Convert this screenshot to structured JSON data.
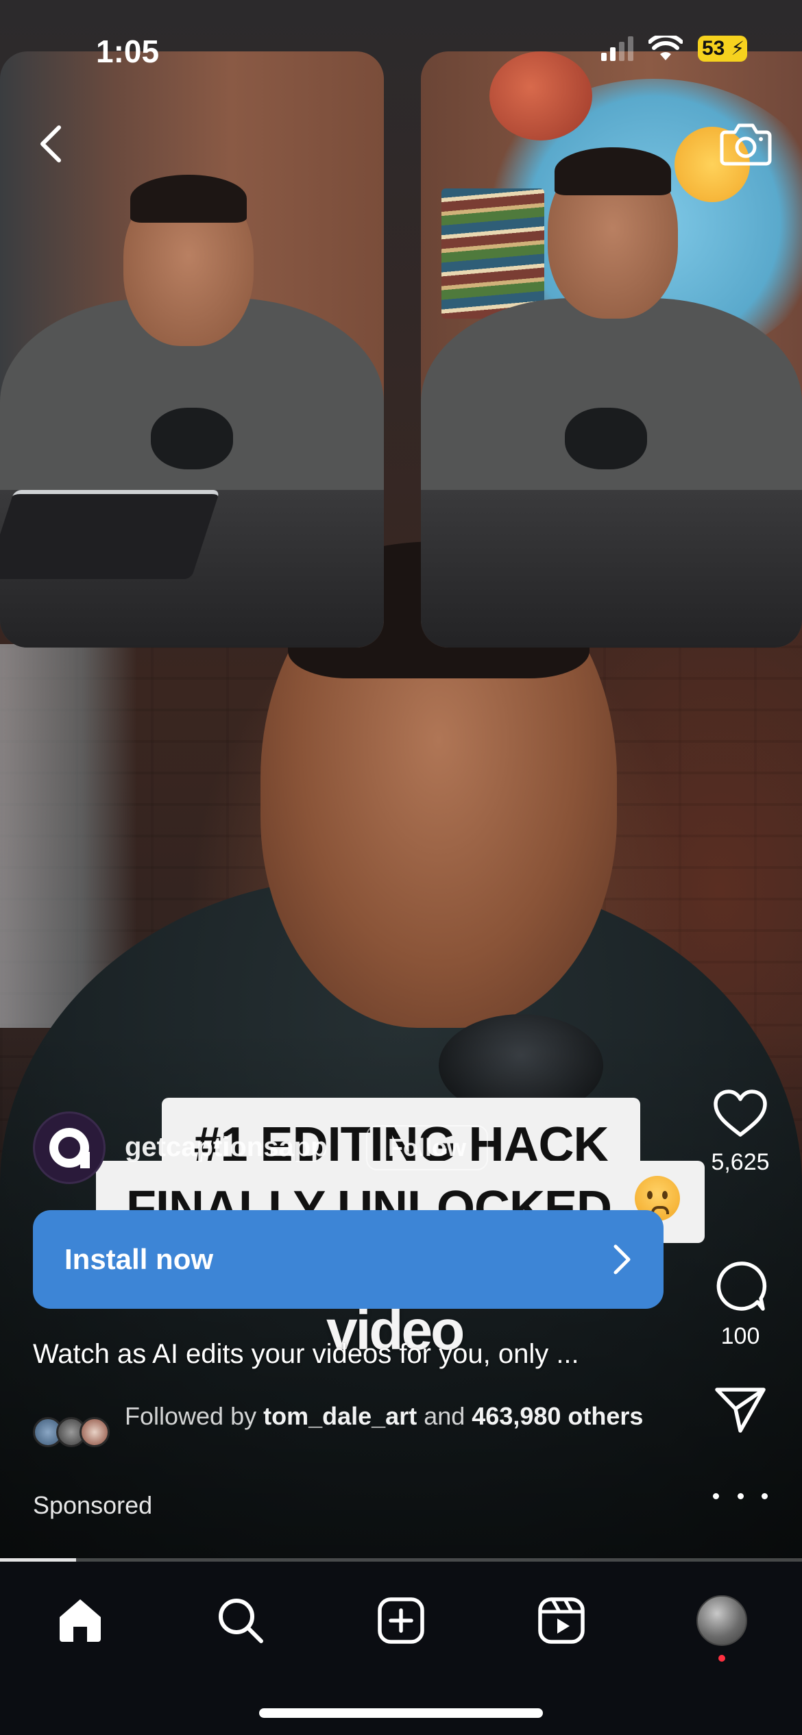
{
  "status_bar": {
    "time": "1:05",
    "battery": "53"
  },
  "video": {
    "caption_line1": "#1 EDITING HACK",
    "caption_line2": "FINALLY UNLOCKED",
    "overlay_word": "video"
  },
  "account": {
    "username": "getcaptionsapp",
    "follow_label": "Follow"
  },
  "cta": {
    "install_label": "Install now"
  },
  "post": {
    "caption": "Watch as AI edits your videos for you, only ...",
    "followed_by_prefix": "Followed by ",
    "followed_by_user": "tom_dale_art",
    "followed_by_and": " and ",
    "followed_by_count": "463,980",
    "followed_by_suffix": " others",
    "sponsored_label": "Sponsored"
  },
  "actions": {
    "likes": "5,625",
    "comments": "100"
  },
  "playback": {
    "progress_fraction": 0.095
  },
  "icons": [
    "back-arrow-icon",
    "camera-icon",
    "heart-icon",
    "comment-icon",
    "send-icon",
    "more-icon",
    "home-icon",
    "search-icon",
    "create-icon",
    "reels-icon",
    "profile-avatar"
  ],
  "colors": {
    "install_button": "#3d85d6",
    "battery": "#f6d21e",
    "notification_dot": "#ff3040"
  }
}
